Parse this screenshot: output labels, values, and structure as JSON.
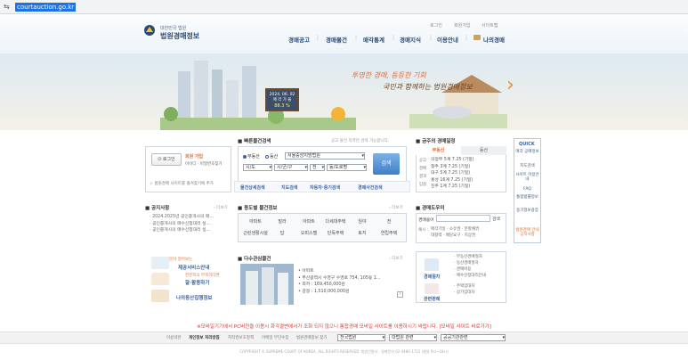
{
  "browser": {
    "url": "courtauction.go.kr"
  },
  "header": {
    "util": [
      "로그인",
      "회원가입",
      "사이트맵"
    ],
    "logo_small": "대한민국 법원",
    "logo_big": "법원경매정보",
    "nav": [
      "경매공고",
      "경매물건",
      "매각통계",
      "경매지식",
      "이용안내",
      "나의경매"
    ]
  },
  "banner": {
    "slogan1": "투명한 경매, 동등한 기회",
    "slogan2": "국민과 함께하는 법원경매정보",
    "board_date": "2024. 06. 02",
    "board_line2": "매 각 가 율",
    "board_value": "88.3 %"
  },
  "login": {
    "button": "로그인",
    "join_title": "회원 가입",
    "join_sub": "아이디 · 비밀번호찾기",
    "hint": "법원경매 사이트를 즐겨찾기에 추가"
  },
  "quick_search": {
    "title": "빠른물건검색",
    "note": "공고 물건 지역만 검색 가능합니다.",
    "radio_real_estate": "부동산",
    "radio_movable": "동산",
    "court_select": "서울중앙지방법원",
    "region1": "시/도",
    "region2": "시/군/구",
    "region3": "전",
    "region4": "동/도로명",
    "search_button": "검색",
    "links": [
      "물건상세검색",
      "지도검색",
      "자동차·중기검색",
      "경매사건검색"
    ]
  },
  "today": {
    "title": "금주의 경매일정",
    "tabs": [
      "부동산",
      "동산"
    ],
    "row_labels": [
      "공고",
      "경매",
      "결과",
      "입찰"
    ],
    "items": [
      "의정부 5계 7.25 (기일)",
      "청주 3계 7.25 (기일)",
      "대구 5계 7.25 (기일)",
      "홍성 16계 7.25 (기일)",
      "진주 1계 7.25 (기일)"
    ]
  },
  "quick_menu": {
    "title": "QUICK",
    "items": [
      "매각 공매정보",
      "지도검색",
      "사이트 이용안내",
      "FAQ",
      "통합법률정보",
      "등기정보광장"
    ],
    "bottom": "법원경매 안내 공지사항"
  },
  "notice": {
    "title": "공지사항",
    "more": "더보기",
    "items": [
      "2024.2025년 공인중개사의 매…",
      "공인중개사의 매수신청대리 실…",
      "공인중개사의 매수신청대리 실…"
    ]
  },
  "categories": {
    "title": "용도별 물건정보",
    "more": "더보기",
    "rows": [
      [
        "아파트",
        "빌라",
        "아파트",
        "다세대주택",
        "임야",
        "전"
      ],
      [
        "근린생활시설",
        "답",
        "오피스텔",
        "단독주택",
        "토지",
        "연립주택"
      ]
    ]
  },
  "search_info": {
    "title": "경매도우미",
    "input_label": "경매용어",
    "search_btn": "검색",
    "examples_label": "예시 :",
    "examples": [
      "매각기일",
      "소유권",
      "분할채권",
      "대항력",
      "배당요구",
      "지상권"
    ]
  },
  "guide": {
    "line1": "쉬운로 전문이 알아보는",
    "title1": "제공서비스안내",
    "line2": "전문지식 부족하다면",
    "title2": "잘·활용하기",
    "title3": "나의동산집행정보"
  },
  "featured": {
    "title": "다수관심물건",
    "more": "더보기",
    "lines": [
      "아파트",
      "부산광역시 수영구 수영로 754, 105동 1…",
      "최저 : 169,450,000원",
      "감정 : 1,510,000,000원"
    ]
  },
  "procedure": {
    "left1": "경매절차",
    "left2": "관련판례",
    "items": [
      "부동산경매절차",
      "동산경매절차",
      "경매비용",
      "매수신청대리안내",
      "주택임대차",
      "상가임대차"
    ]
  },
  "footer": {
    "notice": "※모바일기기에서 PC버전을 이용시 화각결변에서가 조화 되지 않으니 통합경매 모바일 사이트를 이용하시기 바랍니다. [모바일 사이트 바로가기]",
    "links": [
      "이용약관",
      "개인정보 처리방침",
      "저작권보호정책",
      "이메일 무단수집",
      "법원경매정보 찾기"
    ],
    "selects": [
      "전국법원",
      "대법원 관련",
      "공공기관관련"
    ],
    "copyright": "COPYRIGHT © SUPREME COURT OF KOREA. ALL RIGHTS RESERVED.   법원민원사 · 경매문의 02-3480-1715 (평일 9시~18시)"
  }
}
